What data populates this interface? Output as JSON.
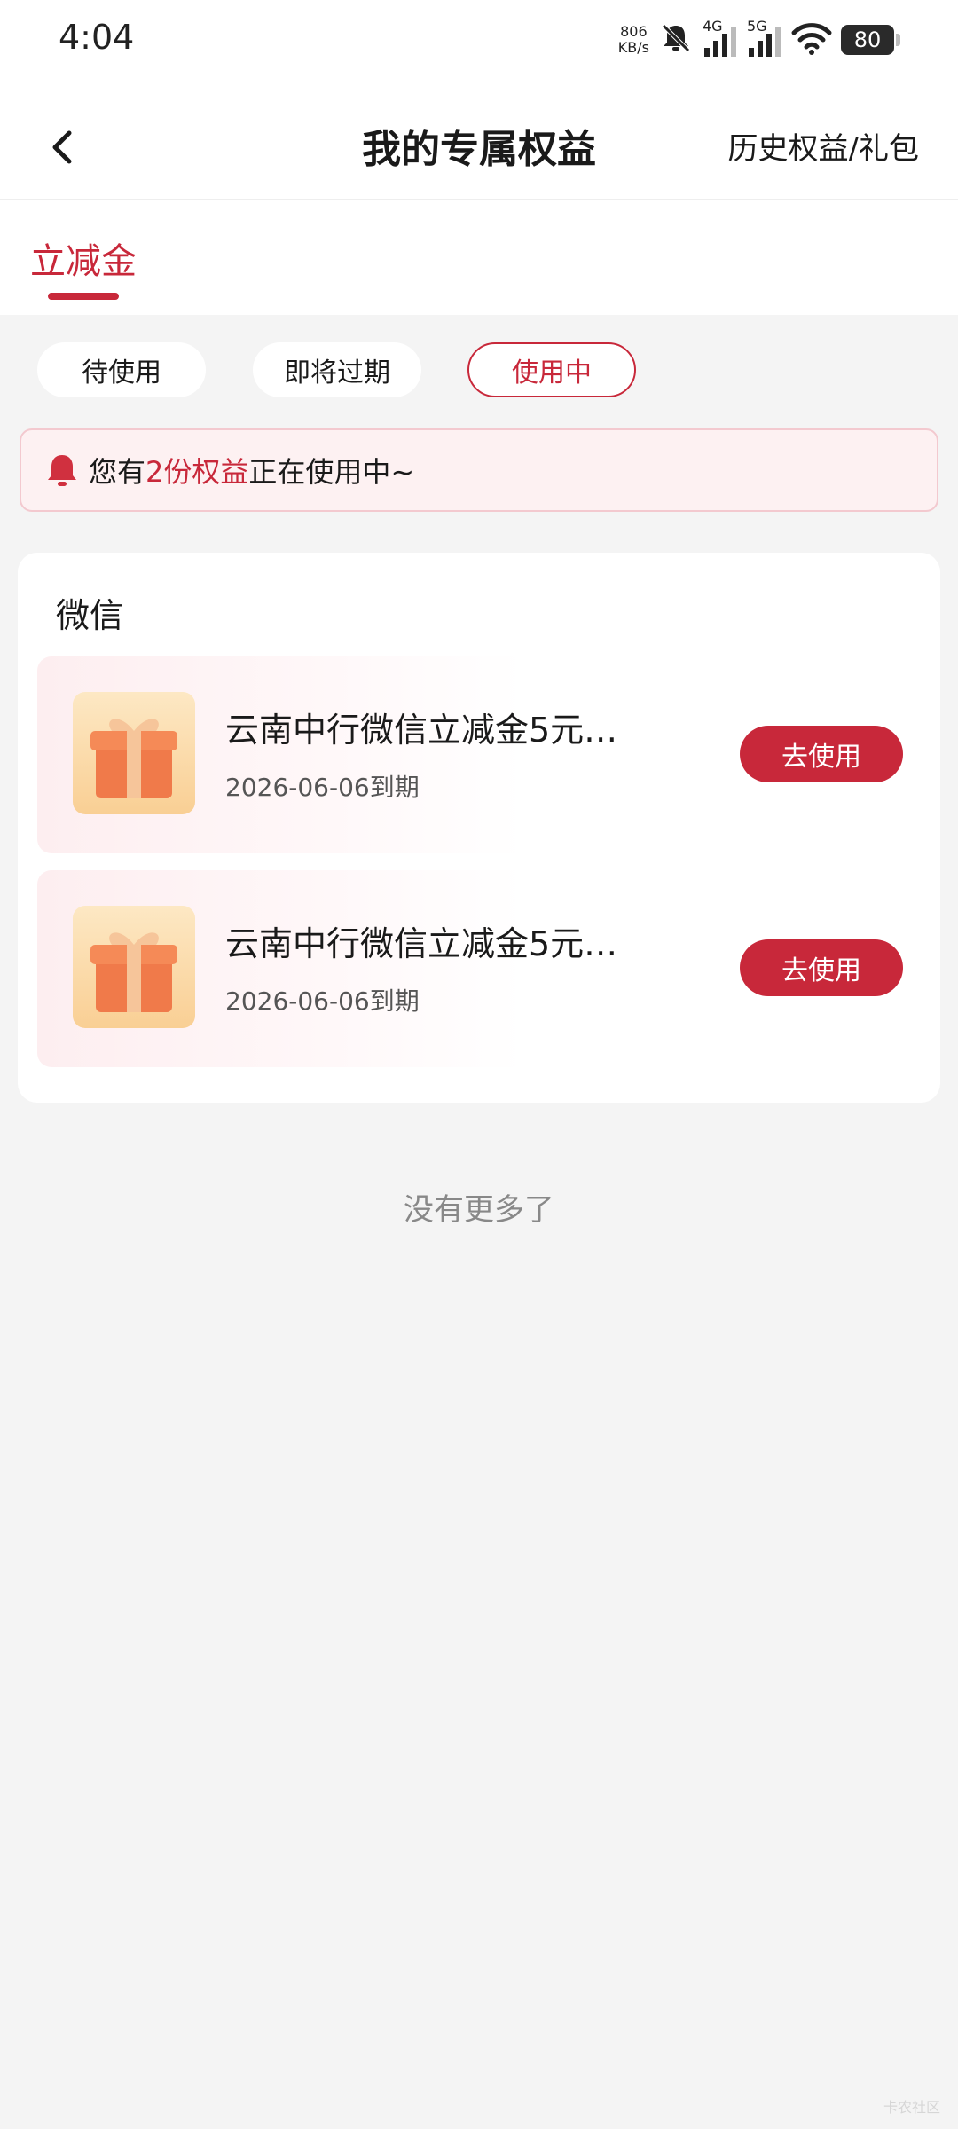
{
  "status_bar": {
    "time": "4:04",
    "net_speed_value": "806",
    "net_speed_unit": "KB/s",
    "signal_1_label": "4G",
    "signal_2_label": "5G",
    "battery": "80"
  },
  "nav": {
    "title": "我的专属权益",
    "history_link": "历史权益/礼包"
  },
  "tabs": [
    {
      "label": "立减金",
      "active": true
    }
  ],
  "filters": [
    {
      "label": "待使用",
      "active": false
    },
    {
      "label": "即将过期",
      "active": false
    },
    {
      "label": "使用中",
      "active": true
    }
  ],
  "notice": {
    "prefix": "您有",
    "highlight": "2份权益",
    "suffix": "正在使用中~"
  },
  "card": {
    "title": "微信",
    "items": [
      {
        "name": "云南中行微信立减金5元…",
        "expiry": "2026-06-06到期",
        "button": "去使用"
      },
      {
        "name": "云南中行微信立减金5元…",
        "expiry": "2026-06-06到期",
        "button": "去使用"
      }
    ]
  },
  "footer": {
    "no_more": "没有更多了",
    "watermark": "卡农社区"
  },
  "colors": {
    "accent": "#c8283a",
    "background": "#f4f4f4",
    "notice_bg": "#fdf1f2"
  },
  "icons": {
    "back": "chevron-left-icon",
    "bell": "bell-icon",
    "gift": "gift-box-icon"
  }
}
